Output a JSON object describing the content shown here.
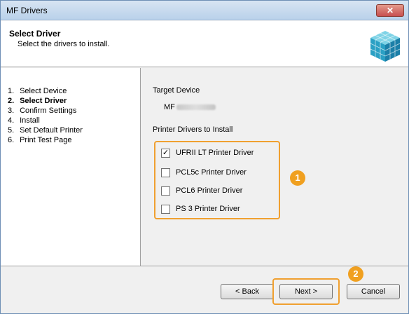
{
  "window": {
    "title": "MF Drivers",
    "close_glyph": "✕"
  },
  "header": {
    "title": "Select Driver",
    "subtitle": "Select the drivers to install.",
    "icon": "installer-cube-icon"
  },
  "steps": [
    {
      "num": "1.",
      "label": "Select Device"
    },
    {
      "num": "2.",
      "label": "Select Driver"
    },
    {
      "num": "3.",
      "label": "Confirm Settings"
    },
    {
      "num": "4.",
      "label": "Install"
    },
    {
      "num": "5.",
      "label": "Set Default Printer"
    },
    {
      "num": "6.",
      "label": "Print Test Page"
    }
  ],
  "current_step": 2,
  "target": {
    "label": "Target Device",
    "value": "MF"
  },
  "drivers": {
    "label": "Printer Drivers to Install",
    "items": [
      {
        "label": "UFRII LT Printer Driver",
        "checked": true
      },
      {
        "label": "PCL5c Printer Driver",
        "checked": false
      },
      {
        "label": "PCL6 Printer Driver",
        "checked": false
      },
      {
        "label": "PS 3 Printer Driver",
        "checked": false
      }
    ]
  },
  "badges": {
    "one": "1",
    "two": "2"
  },
  "buttons": {
    "back": "< Back",
    "next": "Next >",
    "cancel": "Cancel"
  },
  "colors": {
    "highlight": "#f0a030",
    "badge": "#f0a020"
  }
}
